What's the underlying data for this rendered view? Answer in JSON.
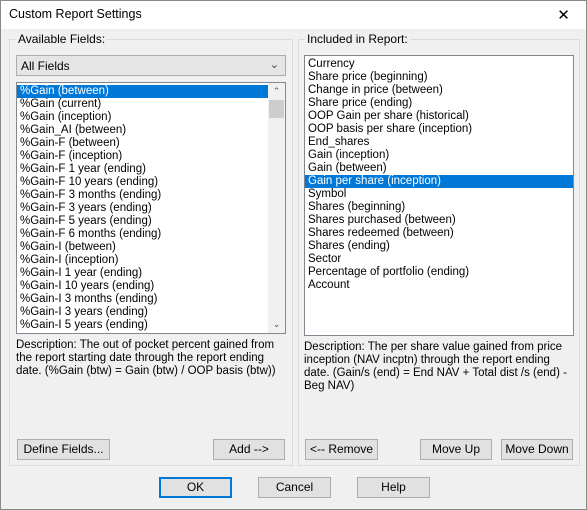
{
  "window": {
    "title": "Custom Report Settings",
    "close": "✕"
  },
  "available": {
    "legend": "Available Fields:",
    "filter": "All Fields",
    "items": [
      "%Gain (between)",
      "%Gain (current)",
      "%Gain (inception)",
      "%Gain_AI (between)",
      "%Gain-F (between)",
      "%Gain-F (inception)",
      "%Gain-F 1 year (ending)",
      "%Gain-F 10 years (ending)",
      "%Gain-F 3 months (ending)",
      "%Gain-F 3 years (ending)",
      "%Gain-F 5 years (ending)",
      "%Gain-F 6 months (ending)",
      "%Gain-I (between)",
      "%Gain-I (inception)",
      "%Gain-I 1 year (ending)",
      "%Gain-I 10 years (ending)",
      "%Gain-I 3 months (ending)",
      "%Gain-I 3 years (ending)",
      "%Gain-I 5 years (ending)"
    ],
    "selected_index": 0,
    "description": "Description: The out of pocket percent gained from the report starting date through the report ending date. (%Gain (btw) = Gain (btw) / OOP basis (btw))",
    "define_button": "Define Fields...",
    "add_button": "Add -->"
  },
  "included": {
    "legend": "Included in Report:",
    "items": [
      "Currency",
      "Share price (beginning)",
      "Change in price (between)",
      "Share price (ending)",
      "OOP Gain per share (historical)",
      "OOP basis per share (inception)",
      "End_shares",
      "Gain (inception)",
      "Gain (between)",
      "Gain per share (inception)",
      "Symbol",
      "Shares (beginning)",
      "Shares purchased (between)",
      "Shares redeemed (between)",
      "Shares (ending)",
      "Sector",
      "Percentage of portfolio (ending)",
      "Account"
    ],
    "selected_index": 9,
    "description": "Description: The per share value gained from price inception (NAV incptn) through the report ending date. (Gain/s (end) = End NAV + Total dist /s (end) - Beg NAV)",
    "remove_button": "<-- Remove",
    "move_up_button": "Move Up",
    "move_down_button": "Move Down"
  },
  "footer": {
    "ok": "OK",
    "cancel": "Cancel",
    "help": "Help"
  },
  "colors": {
    "selection": "#0078d7",
    "default_button_border": "#0078d7"
  }
}
